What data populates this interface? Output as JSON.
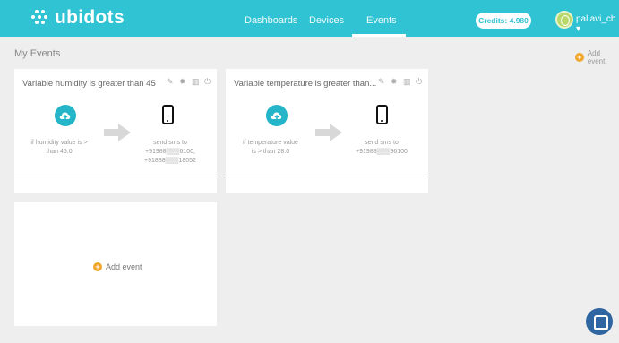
{
  "header": {
    "logo_text": "ubidots",
    "nav": [
      "Dashboards",
      "Devices",
      "Events"
    ],
    "active_nav": "Events",
    "credits": "Credits: 4.980",
    "username": "pallavi_cb"
  },
  "page": {
    "title": "My Events",
    "add_event_label": "Add event"
  },
  "events": [
    {
      "title": "Variable humidity is greater than 45",
      "trigger_text": "if humidity value is > than 45.0",
      "action_lines": [
        "send sms to",
        "+91988▒▒▒6100,",
        "+91888▒▒▒18052"
      ]
    },
    {
      "title": "Variable temperature is greater than...",
      "trigger_text": "if temperature value is > than 28.0",
      "action_lines": [
        "send sms to",
        "+91988▒▒▒96100"
      ]
    }
  ],
  "add_event_card_label": "Add event",
  "colors": {
    "brand": "#2fc3d3",
    "accent": "#f0a52b",
    "chat": "#2f65a0"
  },
  "icons": [
    "upload-cloud-icon",
    "phone-icon",
    "arrow-right-icon",
    "edit-icon",
    "settings-icon",
    "delete-icon",
    "power-icon",
    "plus-icon",
    "chat-icon",
    "avatar"
  ]
}
